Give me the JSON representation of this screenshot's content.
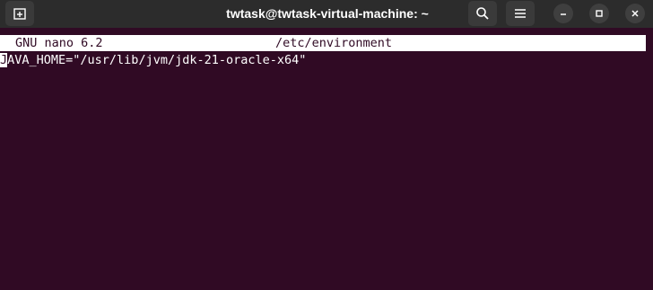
{
  "window": {
    "title": "twtask@twtask-virtual-machine: ~"
  },
  "titlebar": {
    "icons": {
      "new_tab": "new-tab-icon",
      "search": "search-icon",
      "menu": "hamburger-menu-icon",
      "minimize": "minimize-icon",
      "maximize": "maximize-icon",
      "close": "close-icon"
    }
  },
  "nano": {
    "version": "GNU nano 6.2",
    "filename": "/etc/environment",
    "lines": [
      {
        "cursor_char": "J",
        "rest": "AVA_HOME=\"/usr/lib/jvm/jdk-21-oracle-x64\""
      }
    ]
  },
  "colors": {
    "terminal_bg": "#300a24",
    "titlebar_bg": "#2c2c2c",
    "header_bg": "#ffffff",
    "text": "#ffffff"
  }
}
